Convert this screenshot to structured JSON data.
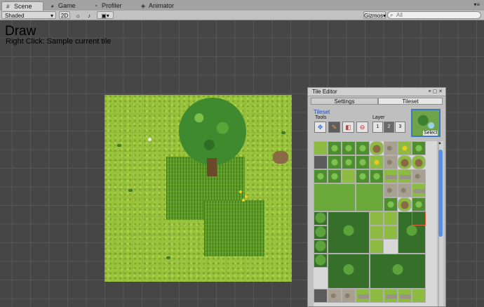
{
  "tabs": [
    {
      "label": "Scene",
      "icon": "grid-icon",
      "active": true
    },
    {
      "label": "Game",
      "icon": "pacman-icon",
      "active": false
    },
    {
      "label": "Profiler",
      "icon": "profiler-icon",
      "active": false
    },
    {
      "label": "Animator",
      "icon": "animator-icon",
      "active": false
    }
  ],
  "toolbar": {
    "shading_mode": "Shaded",
    "mode_2d": "2D",
    "gizmos": "Gizmos",
    "search_placeholder": "All"
  },
  "scene": {
    "title": "Draw",
    "hint": "Right Click: Sample current tile"
  },
  "tile_editor": {
    "title": "Tile Editor",
    "tabs": [
      "Settings",
      "Tileset"
    ],
    "active_tab": "Tileset",
    "section_title": "Tileset",
    "tools_label": "Tools",
    "layer_label": "Layer",
    "tools": [
      "move-tool-icon",
      "paint-tool-icon",
      "eraser-tool-icon",
      "delete-tool-icon"
    ],
    "selected_tool": "paint-tool-icon",
    "layers": [
      "1",
      "2",
      "3"
    ],
    "selected_layer": "2",
    "thumbnail_label": "Select"
  },
  "colors": {
    "scene_bg": "#464646",
    "grass": "#9bc43d",
    "accent_blue": "#3b78c5"
  }
}
